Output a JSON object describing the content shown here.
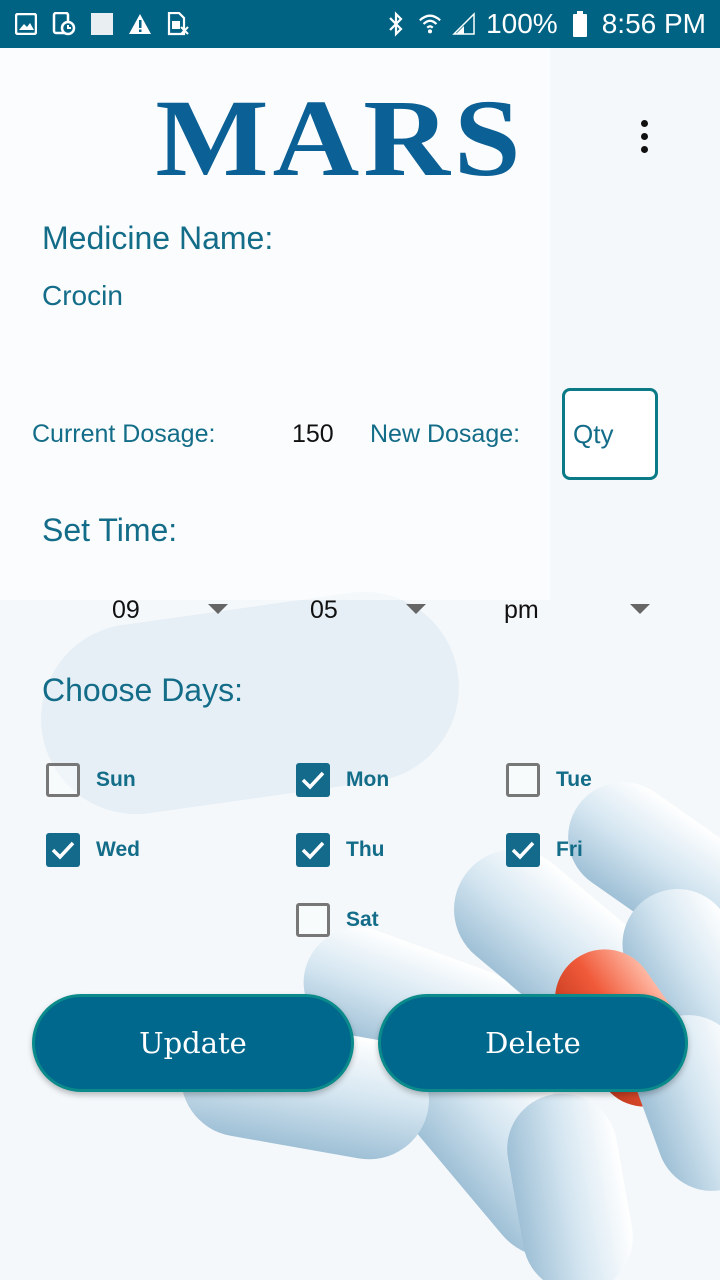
{
  "status_bar": {
    "battery": "100%",
    "time": "8:56 PM",
    "icons": [
      "image-icon",
      "schedule-icon",
      "square-icon",
      "warning-icon",
      "sim-icon",
      "bluetooth-icon",
      "wifi-icon",
      "signal-icon",
      "battery-icon"
    ]
  },
  "header": {
    "logo": "MARS",
    "menu_icon": "more-vert-icon"
  },
  "medicine": {
    "label": "Medicine Name:",
    "value": "Crocin"
  },
  "dosage": {
    "current_label": "Current Dosage:",
    "current_value": "150",
    "new_label": "New Dosage:",
    "new_placeholder": "Qty"
  },
  "time": {
    "label": "Set Time:",
    "hour": "09",
    "minute": "05",
    "ampm": "pm"
  },
  "days": {
    "label": "Choose Days:",
    "items": [
      {
        "name": "Sun",
        "checked": false
      },
      {
        "name": "Mon",
        "checked": true
      },
      {
        "name": "Tue",
        "checked": false
      },
      {
        "name": "Wed",
        "checked": true
      },
      {
        "name": "Thu",
        "checked": true
      },
      {
        "name": "Fri",
        "checked": true
      },
      {
        "name": "Sat",
        "checked": false
      }
    ]
  },
  "actions": {
    "update": "Update",
    "delete": "Delete"
  },
  "colors": {
    "primary": "#00688c",
    "text": "#136c88",
    "logo": "#0b6096"
  }
}
